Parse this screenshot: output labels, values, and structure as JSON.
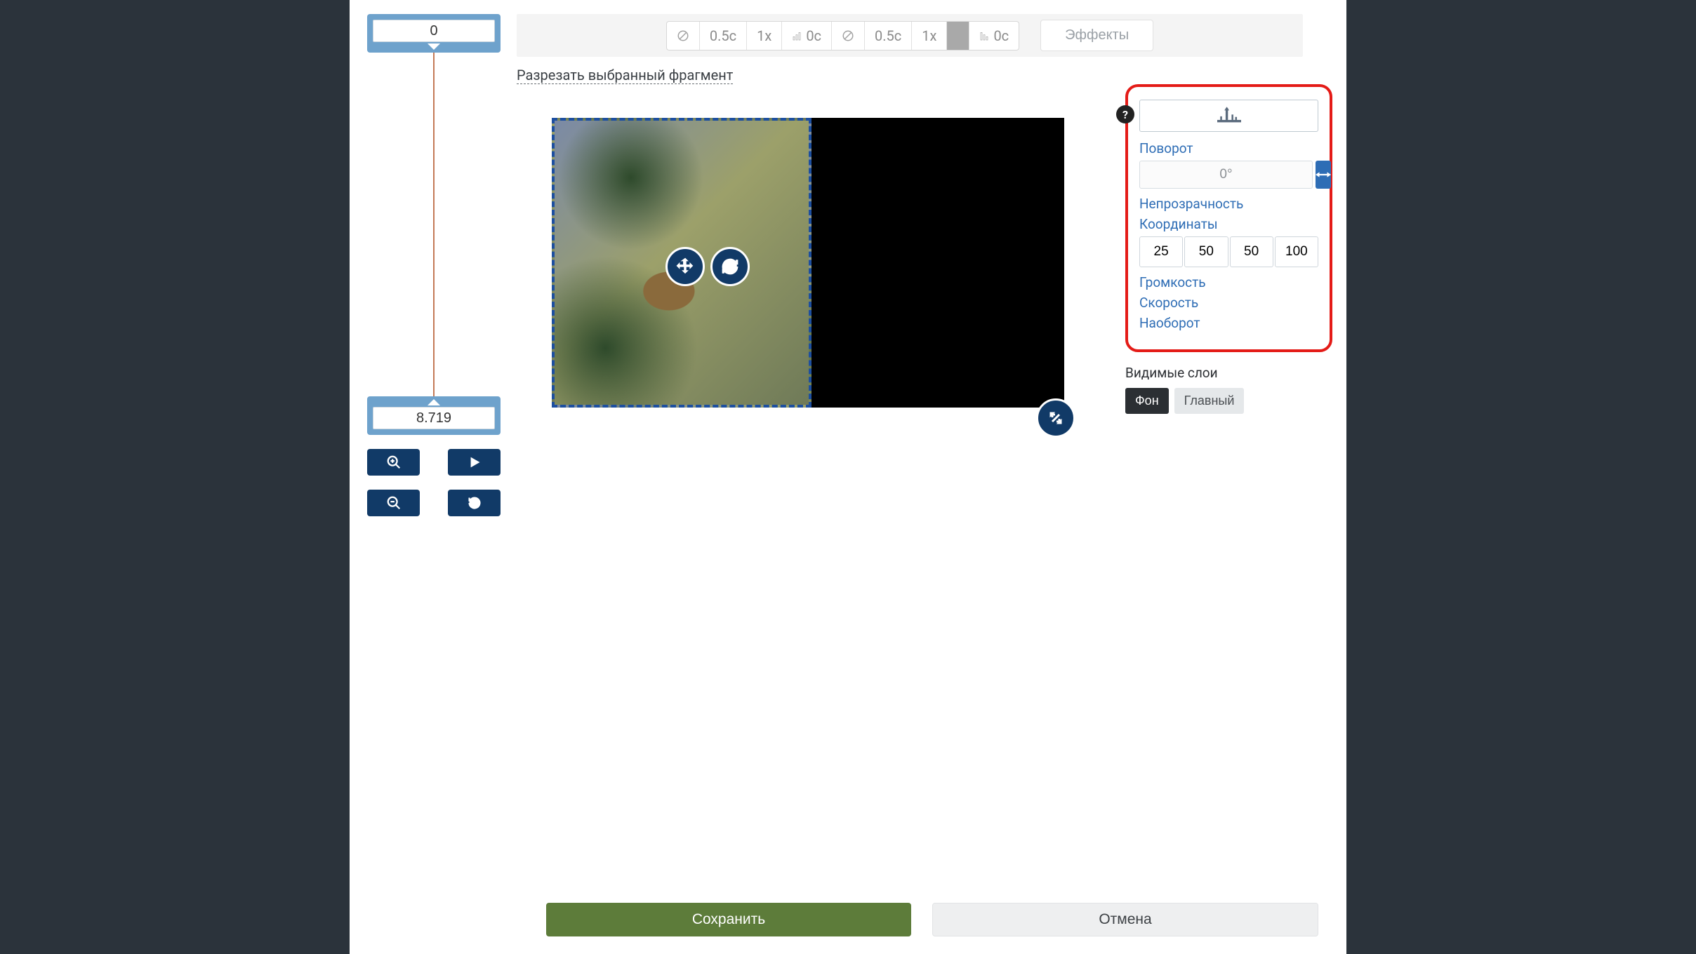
{
  "timeline": {
    "start_value": "0",
    "end_value": "8.719"
  },
  "toolbar": {
    "group_a": {
      "dur": "0.5с",
      "speed": "1x",
      "fade": "0с"
    },
    "group_b": {
      "dur": "0.5с",
      "speed": "1x",
      "fade": "0с"
    },
    "effects_label": "Эффекты"
  },
  "cut_link": "Разрезать выбранный фрагмент",
  "panel": {
    "rotation_label": "Поворот",
    "rotation_value": "0°",
    "opacity_label": "Непрозрачность",
    "coords_label": "Координаты",
    "coords": [
      "25",
      "50",
      "50",
      "100"
    ],
    "volume_label": "Громкость",
    "speed_label": "Скорость",
    "reverse_label": "Наоборот",
    "help": "?"
  },
  "layers": {
    "title": "Видимые слои",
    "bg": "Фон",
    "main": "Главный"
  },
  "footer": {
    "save": "Сохранить",
    "cancel": "Отмена"
  }
}
